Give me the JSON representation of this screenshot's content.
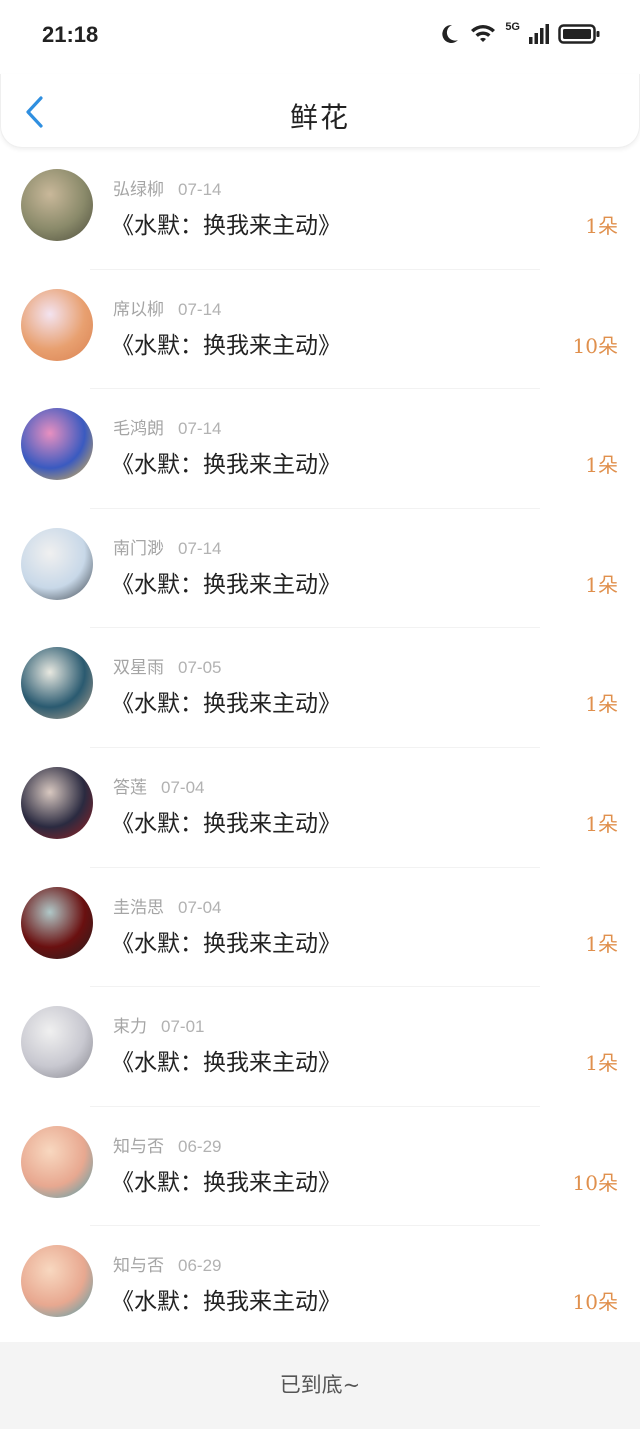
{
  "status": {
    "time": "21:18",
    "network": "5G"
  },
  "header": {
    "title": "鲜花"
  },
  "items": [
    {
      "user": "弘绿柳",
      "date": "07-14",
      "title": "《水默：换我来主动》",
      "count": "1朵",
      "avatar_colors": [
        "#8a8a6a",
        "#c9b89a",
        "#4a4a3a"
      ]
    },
    {
      "user": "席以柳",
      "date": "07-14",
      "title": "《水默：换我来主动》",
      "count": "10朵",
      "avatar_colors": [
        "#e8a070",
        "#f3e3f0",
        "#d98050"
      ]
    },
    {
      "user": "毛鸿朗",
      "date": "07-14",
      "title": "《水默：换我来主动》",
      "count": "1朵",
      "avatar_colors": [
        "#3a5ac0",
        "#e890c0",
        "#f0c040"
      ]
    },
    {
      "user": "南门渺",
      "date": "07-14",
      "title": "《水默：换我来主动》",
      "count": "1朵",
      "avatar_colors": [
        "#c8d8e8",
        "#f0f0f0",
        "#303840"
      ]
    },
    {
      "user": "双星雨",
      "date": "07-05",
      "title": "《水默：换我来主动》",
      "count": "1朵",
      "avatar_colors": [
        "#2a5a70",
        "#e8e8e0",
        "#c0a890"
      ]
    },
    {
      "user": "答莲",
      "date": "07-04",
      "title": "《水默：换我来主动》",
      "count": "1朵",
      "avatar_colors": [
        "#2a2a40",
        "#d8c8c0",
        "#a02020"
      ]
    },
    {
      "user": "圭浩思",
      "date": "07-04",
      "title": "《水默：换我来主动》",
      "count": "1朵",
      "avatar_colors": [
        "#6a1010",
        "#b0c8c8",
        "#202020"
      ]
    },
    {
      "user": "束力",
      "date": "07-01",
      "title": "《水默：换我来主动》",
      "count": "1朵",
      "avatar_colors": [
        "#c8c8d0",
        "#f0f0f0",
        "#808088"
      ]
    },
    {
      "user": "知与否",
      "date": "06-29",
      "title": "《水默：换我来主动》",
      "count": "10朵",
      "avatar_colors": [
        "#e8a890",
        "#f8d8c0",
        "#40a0b0"
      ]
    },
    {
      "user": "知与否",
      "date": "06-29",
      "title": "《水默：换我来主动》",
      "count": "10朵",
      "avatar_colors": [
        "#e8a890",
        "#f8d8c0",
        "#40a0b0"
      ]
    }
  ],
  "footer": {
    "text": "已到底~"
  },
  "colors": {
    "accent": "#2f8fe0",
    "count": "#e0904d"
  }
}
